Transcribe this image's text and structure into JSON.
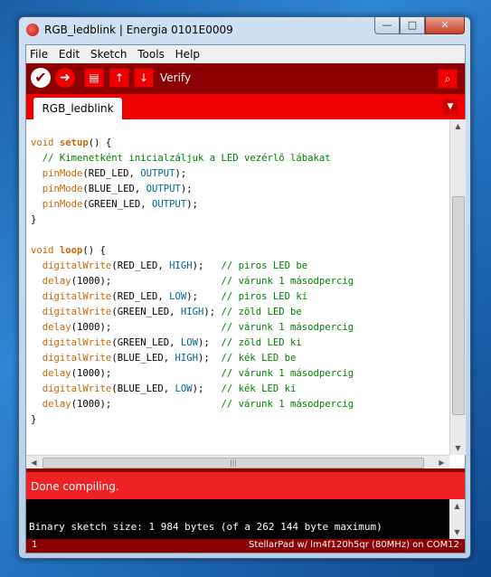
{
  "window": {
    "title": "RGB_ledblink | Energia 0101E0009",
    "controls": {
      "minimize": "—",
      "maximize": "□",
      "close": "✕"
    }
  },
  "menu": [
    "File",
    "Edit",
    "Sketch",
    "Tools",
    "Help"
  ],
  "toolbar": {
    "verify_icon": "✔",
    "upload_icon": "➜",
    "new_icon": "▤",
    "open_icon": "↑",
    "save_icon": "↓",
    "status_label": "Verify",
    "serial_monitor_icon": "⌕"
  },
  "tabs": [
    {
      "label": "RGB_ledblink"
    }
  ],
  "tab_menu_icon": "▼",
  "code_lines": [
    "void setup() {",
    "  // Kimenetként inicialzáljuk a LED vezérlő lábakat",
    "  pinMode(RED_LED, OUTPUT);",
    "  pinMode(BLUE_LED, OUTPUT);",
    "  pinMode(GREEN_LED, OUTPUT);",
    "}",
    "",
    "void loop() {",
    "  digitalWrite(RED_LED, HIGH);   // piros LED be",
    "  delay(1000);                   // várunk 1 másodpercig",
    "  digitalWrite(RED_LED, LOW);    // piros LED ki",
    "  digitalWrite(GREEN_LED, HIGH); // zöld LED be",
    "  delay(1000);                   // várunk 1 másodpercig",
    "  digitalWrite(GREEN_LED, LOW);  // zöld LED ki",
    "  digitalWrite(BLUE_LED, HIGH);  // kék LED be",
    "  delay(1000);                   // várunk 1 másodpercig",
    "  digitalWrite(BLUE_LED, LOW);   // kék LED ki",
    "  delay(1000);                   // várunk 1 másodpercig",
    "}"
  ],
  "status": {
    "message": "Done compiling."
  },
  "console": {
    "output": "Binary sketch size: 1 984 bytes (of a 262 144 byte maximum)"
  },
  "footer": {
    "line_number": "1",
    "board": "StellarPad w/ lm4f120h5qr (80MHz) on COM12"
  },
  "colors": {
    "toolbar": "#8b0000",
    "tabbar": "#ee0000",
    "status": "#ee2222",
    "keyword": "#cc6600",
    "constant": "#006699",
    "comment": "#008000"
  }
}
